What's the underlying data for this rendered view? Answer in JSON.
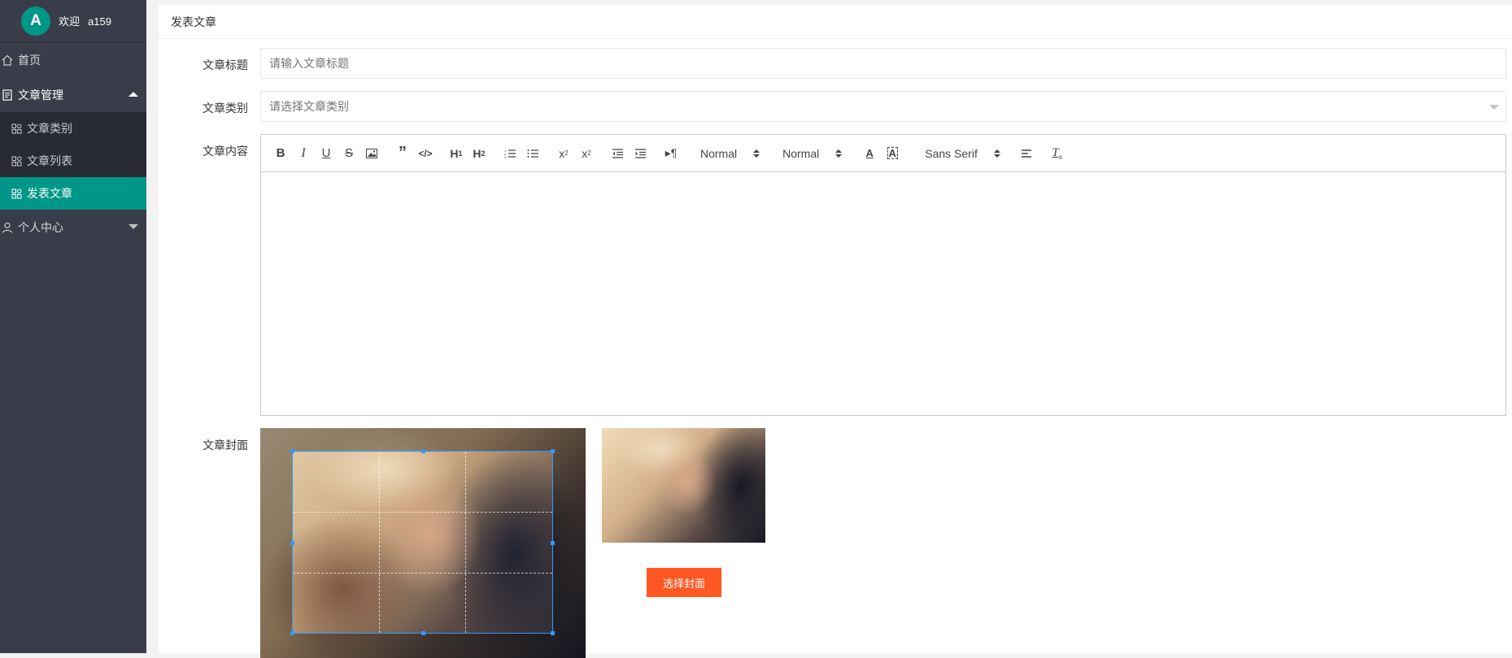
{
  "user": {
    "avatar_letter": "A",
    "welcome": "欢迎",
    "username": "a159"
  },
  "sidebar": {
    "items": [
      {
        "label": "首页",
        "icon": "home-icon"
      },
      {
        "label": "文章管理",
        "icon": "document-icon",
        "expanded": true,
        "children": [
          {
            "label": "文章类别",
            "icon": "apps-icon"
          },
          {
            "label": "文章列表",
            "icon": "apps-icon"
          },
          {
            "label": "发表文章",
            "icon": "apps-icon",
            "active": true
          }
        ]
      },
      {
        "label": "个人中心",
        "icon": "user-icon",
        "expanded": false
      }
    ]
  },
  "panel": {
    "title": "发表文章"
  },
  "form": {
    "title_label": "文章标题",
    "title_placeholder": "请输入文章标题",
    "category_label": "文章类别",
    "category_placeholder": "请选择文章类别",
    "content_label": "文章内容",
    "cover_label": "文章封面",
    "select_cover_button": "选择封面"
  },
  "editor": {
    "toolbar": [
      "bold",
      "italic",
      "underline",
      "strike",
      "image",
      "blockquote",
      "code-block",
      "header-1",
      "header-2",
      "ordered-list",
      "bullet-list",
      "subscript",
      "superscript",
      "indent-decrease",
      "indent-increase",
      "direction-rtl",
      "size",
      "header",
      "color",
      "background",
      "font",
      "align",
      "clean"
    ],
    "size_value": "Normal",
    "header_value": "Normal",
    "font_value": "Sans Serif"
  },
  "colors": {
    "primary": "#009688",
    "sidebar_bg": "#393d49",
    "sidebar_sub_bg": "#282b33",
    "accent_button": "#ff5722"
  }
}
